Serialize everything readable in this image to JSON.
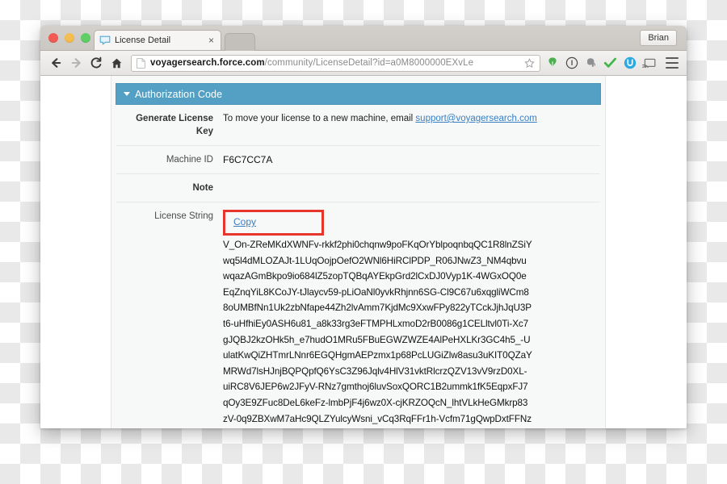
{
  "browser": {
    "traffic_lights": [
      "close",
      "minimize",
      "zoom"
    ],
    "tab": {
      "title": "License Detail",
      "close_label": "×",
      "favicon": "speech-bubble-icon"
    },
    "profile_chip": "Brian",
    "toolbar": {
      "back": "back-arrow",
      "forward": "forward-arrow",
      "reload": "reload-arrow",
      "home": "home-glyph",
      "url_host": "voyagersearch.force.com",
      "url_path": "/community/LicenseDetail?id=a0M8000000EXvLe",
      "url_full": "voyagersearch.force.com/community/LicenseDetail?id=a0M8000000EXvLe",
      "bookmark": "star-outline",
      "extensions": [
        "evernote-green-icon",
        "info-circle-icon",
        "elephant-gray-icon",
        "green-check-icon",
        "blue-u-icon",
        "cast-screen-icon"
      ],
      "menu": "hamburger-menu"
    }
  },
  "page": {
    "section": {
      "title": "Authorization Code",
      "collapsed": false,
      "header_color": "#54a0c4"
    },
    "fields": [
      {
        "label": "Generate License Key",
        "label_bold": true,
        "text_prefix": "To move your license to a new machine, email ",
        "link_text": "support@voyagersearch.com"
      },
      {
        "label": "Machine ID",
        "label_bold": false,
        "value": "F6C7CC7A"
      },
      {
        "label": "Note",
        "label_bold": true,
        "value": ""
      },
      {
        "label": "License String",
        "label_bold": false,
        "copy_label": "Copy",
        "highlight_color": "#e8352b"
      }
    ],
    "license_string_lines": [
      "V_On-ZReMKdXWNFv-rkkf2phi0chqnw9poFKqOrYblpoqnbqQC1R8lnZSiY",
      "wq5l4dMLOZAJt-1LUqOojpOefO2WNl6HiRClPDP_R06JNwZ3_NM4qbvu",
      "wqazAGmBkpo9io684lZ5zopTQBqAYEkpGrd2lCxDJ0Vyp1K-4WGxOQ0e",
      "EqZnqYiL8KCoJY-tJlaycv59-pLiOaNl0yvkRhjnn6SG-Cl9C67u6xqgliWCm8",
      "8oUMBfNn1Uk2zbNfape44Zh2lvAmm7KjdMc9XxwFPy822yTCckJjhJqU3P",
      "t6-uHfhiEy0ASH6u81_a8k33rg3eFTMPHLxmoD2rB0086g1CELltvl0Ti-Xc7",
      "gJQBJ2kzOHk5h_e7hudO1MRu5FBuEGWZWZE4AlPeHXLKr3GC4h5_-U",
      "ulatKwQiZHTmrLNnr6EGQHgmAEPzmx1p68PcLUGiZlw8asu3uKIT0QZaY",
      "MRWd7lsHJnjBQPQpfQ6YsC3Z96Jqlv4HlV31vktRlcrzQZV13vV9rzD0XL-",
      "uiRC8V6JEP6w2JFyV-RNz7gmthoj6luvSoxQORC1B2ummk1fK5EqpxFJ7",
      "qOy3E9ZFuc8DeL6keFz-lmbPjF4j6wz0X-cjKRZOQcN_lhtVLkHeGMkrp83",
      "zV-0q9ZBXwM7aHc9QLZYulcyWsni_vCq3RqFFr1h-Vcfm71gQwpDxtFFNz"
    ]
  }
}
